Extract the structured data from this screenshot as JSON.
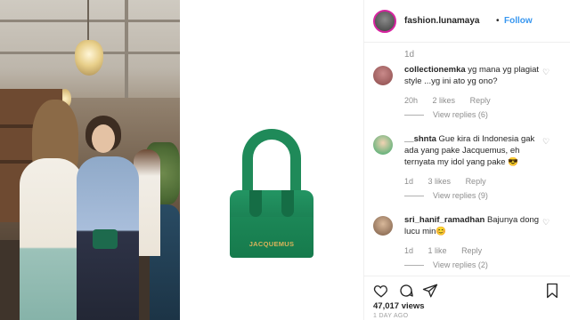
{
  "post": {
    "username": "fashion.lunamaya",
    "dot": "•",
    "follow_label": "Follow",
    "top_time": "1d",
    "product_brand": "JACQUEMUS",
    "views": "47,017 views",
    "date_partial": "1 DAY AGO"
  },
  "comments": [
    {
      "username": "collectionemka",
      "text": "yg mana yg plagiat style ...yg ini ato yg ono?",
      "time": "20h",
      "likes": "2 likes",
      "reply": "Reply",
      "view_replies": "View replies (6)",
      "avatar_color": "#8a4a4a"
    },
    {
      "username": "__shnta",
      "text": "Gue kira di Indonesia gak ada yang pake Jacquemus, eh ternyata my idol yang pake 😎",
      "time": "1d",
      "likes": "3 likes",
      "reply": "Reply",
      "view_replies": "View replies (9)",
      "avatar_color": "#3aa86a"
    },
    {
      "username": "sri_hanif_ramadhan",
      "text": "Bajunya dong lucu min😊",
      "time": "1d",
      "likes": "1 like",
      "reply": "Reply",
      "view_replies": "View replies (2)",
      "avatar_color": "#a07a5a"
    }
  ],
  "icons": {
    "heart": "heart-icon",
    "comment": "comment-icon",
    "share": "share-icon",
    "save": "bookmark-icon"
  },
  "colors": {
    "follow": "#3897f0",
    "bag_green": "#1f8a59",
    "brand_gold": "#d9b35a"
  }
}
